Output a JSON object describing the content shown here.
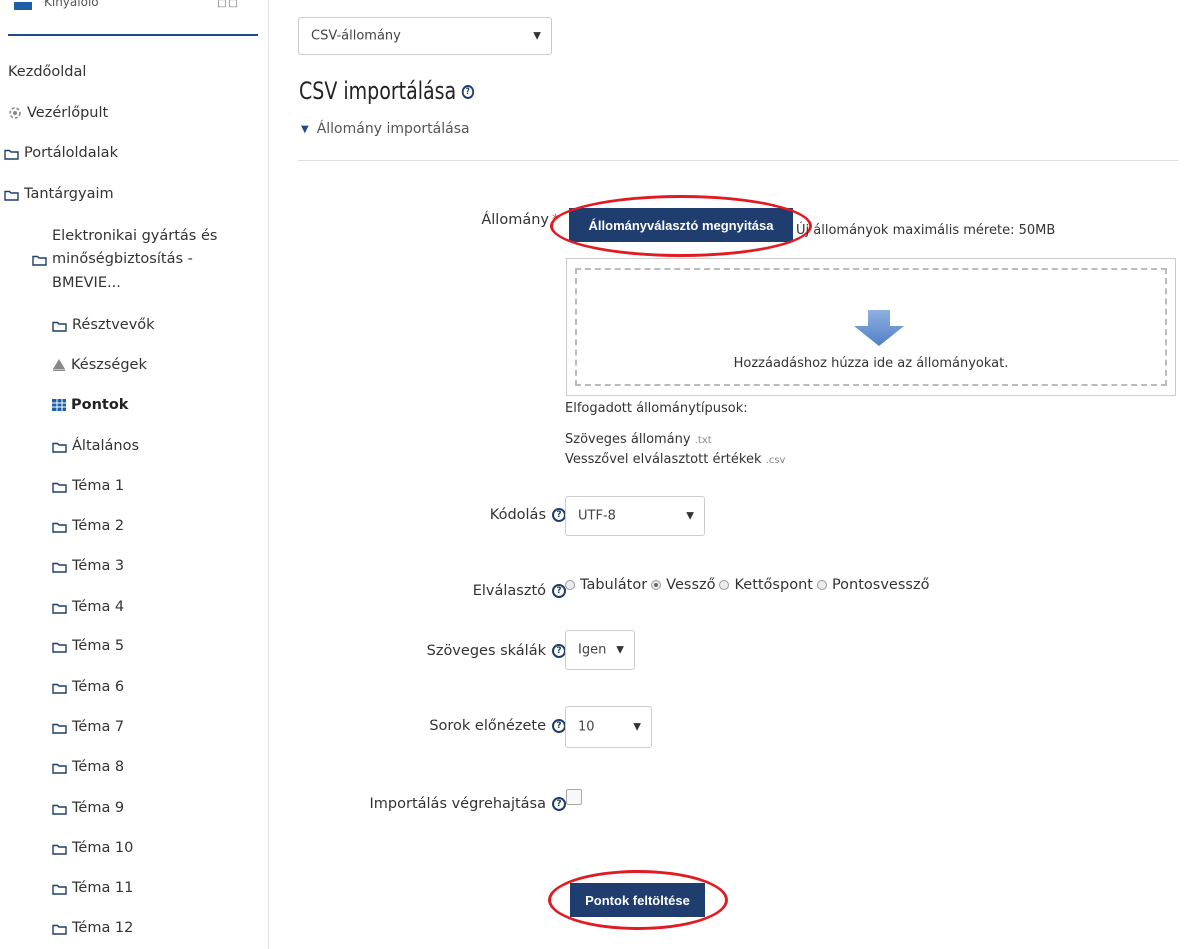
{
  "sidebar": {
    "top_label": "Kinyalolo",
    "top_right": "□□",
    "home": "Kezdőoldal",
    "dashboard": "Vezérlőpult",
    "site_pages": "Portáloldalak",
    "my_courses": "Tantárgyaim",
    "course_line1": "Elektronikai gyártás és",
    "course_line2": "minőségbiztosítás -",
    "course_line3": "BMEVIE...",
    "participants": "Résztvevők",
    "competencies": "Készségek",
    "grades": "Pontok",
    "general": "Általános",
    "topics": [
      "Téma 1",
      "Téma 2",
      "Téma 3",
      "Téma 4",
      "Téma 5",
      "Téma 6",
      "Téma 7",
      "Téma 8",
      "Téma 9",
      "Téma 10",
      "Téma 11",
      "Téma 12"
    ]
  },
  "main": {
    "import_type": "CSV-állomány",
    "title": "CSV importálása",
    "section": "Állomány importálása",
    "file_label": "Állomány",
    "choose_button": "Állományválasztó megnyitása",
    "max_size": "Új állományok maximális mérete: 50MB",
    "drop_text": "Hozzáadáshoz húzza ide az állományokat.",
    "accepted_title": "Elfogadott állománytípusok:",
    "type1_name": "Szöveges állomány",
    "type1_ext": ".txt",
    "type2_name": "Vesszővel elválasztott értékek",
    "type2_ext": ".csv",
    "encoding_label": "Kódolás",
    "encoding_value": "UTF-8",
    "separator_label": "Elválasztó",
    "separator_options": [
      "Tabulátor",
      "Vessző",
      "Kettőspont",
      "Pontosvessző"
    ],
    "separator_selected": "Vessző",
    "verbose_label": "Szöveges skálák",
    "verbose_value": "Igen",
    "preview_label": "Sorok előnézete",
    "preview_value": "10",
    "force_label": "Importálás végrehajtása",
    "force_checked": false,
    "submit_button": "Pontok feltöltése",
    "accent_color": "#1f3d6e",
    "highlight_color": "#e01b22"
  }
}
